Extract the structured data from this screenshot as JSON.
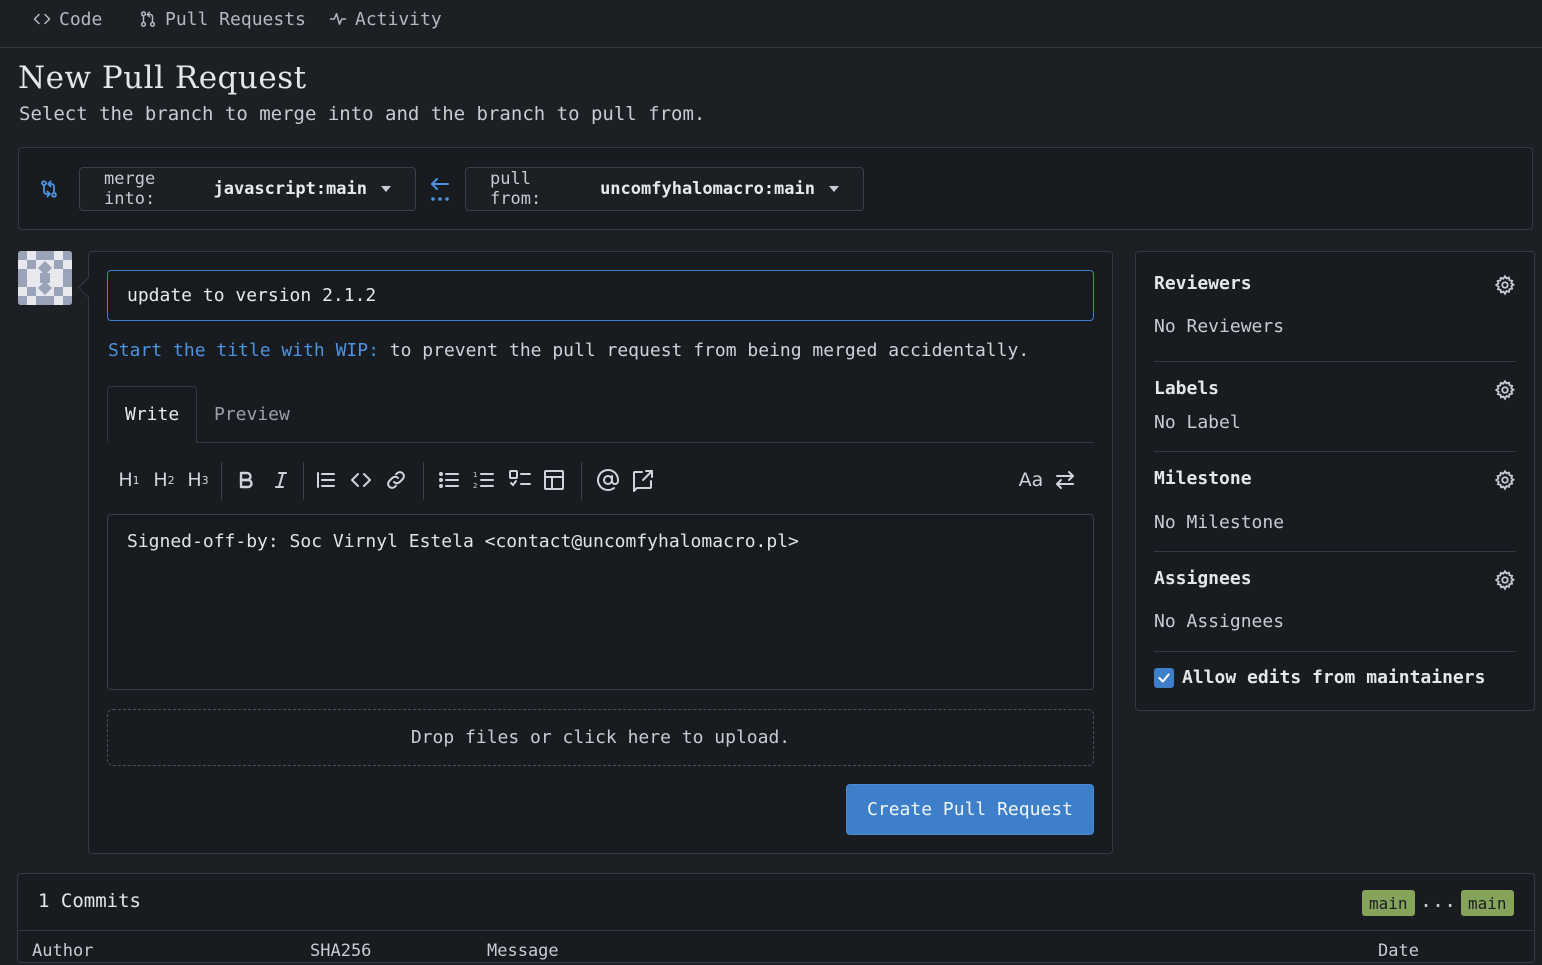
{
  "repo_tabs": [
    {
      "label": "Code",
      "icon": "code-icon"
    },
    {
      "label": "Pull Requests",
      "icon": "git-pull-request-icon"
    },
    {
      "label": "Activity",
      "icon": "pulse-icon"
    }
  ],
  "page": {
    "title": "New Pull Request",
    "subtitle": "Select the branch to merge into and the branch to pull from."
  },
  "branches": {
    "merge_prefix": "merge into:",
    "merge_value": "javascript:main",
    "pull_prefix": "pull from:",
    "pull_value": "uncomfyhalomacro:main"
  },
  "form": {
    "title_value": "update to version 2.1.2",
    "wip_link": "Start the title with WIP:",
    "wip_rest": " to prevent the pull request from being merged accidentally.",
    "tab_write": "Write",
    "tab_preview": "Preview",
    "body_value": "Signed-off-by: Soc Virnyl Estela <contact@uncomfyhalomacro.pl>",
    "dropzone": "Drop files or click here to upload.",
    "create_label": "Create Pull Request",
    "font_toggle": "Aa"
  },
  "sidebar": {
    "reviewers_head": "Reviewers",
    "reviewers_value": "No Reviewers",
    "labels_head": "Labels",
    "labels_value": "No Label",
    "milestone_head": "Milestone",
    "milestone_value": "No Milestone",
    "assignees_head": "Assignees",
    "assignees_value": "No Assignees",
    "allow_edits": "Allow edits from maintainers",
    "allow_edits_checked": true
  },
  "commits": {
    "head": "1 Commits",
    "base_tag": "main",
    "head_tag": "main",
    "separator": "...",
    "columns": [
      "Author",
      "SHA256",
      "Message",
      "Date"
    ]
  },
  "colors": {
    "accent": "#3d7fc9",
    "link": "#4f93e0",
    "branch_tag": "#85a35a",
    "background": "#1c1f24"
  }
}
